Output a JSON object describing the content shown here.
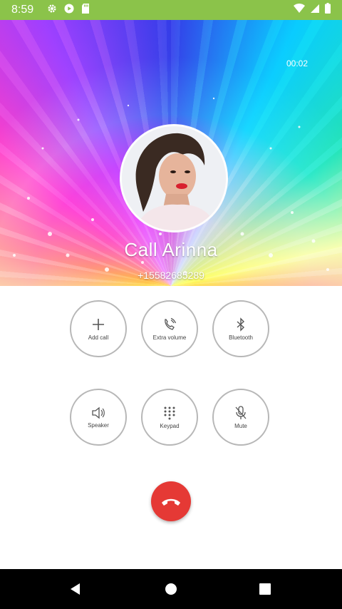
{
  "status_bar": {
    "time": "8:59",
    "left_icons": [
      "gear-icon",
      "play-icon",
      "sd-card-icon"
    ],
    "right_icons": [
      "wifi-icon",
      "cell-signal-icon",
      "battery-icon"
    ],
    "color": "#8bc34a"
  },
  "call": {
    "timer": "00:02",
    "caller_name": "Call Arinna",
    "caller_number": "+15582685289"
  },
  "actions": {
    "add_call": "Add call",
    "extra_volume": "Extra volume",
    "bluetooth": "Bluetooth",
    "speaker": "Speaker",
    "keypad": "Keypad",
    "mute": "Mute"
  },
  "end_call": {
    "icon": "phone-hangup-icon",
    "color": "#e53935"
  },
  "nav": {
    "icons": [
      "back-icon",
      "home-icon",
      "recents-icon"
    ]
  }
}
